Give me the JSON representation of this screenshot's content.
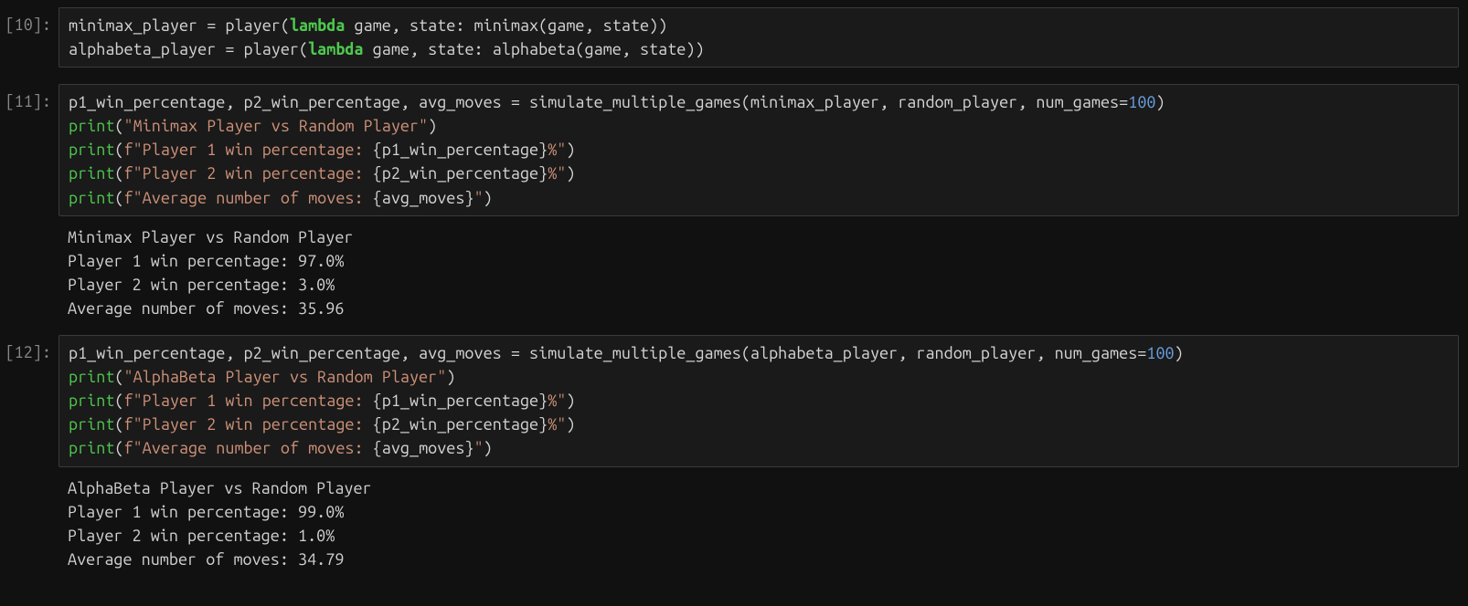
{
  "cells": [
    {
      "prompt": "[10]:",
      "code": [
        [
          {
            "t": "minimax_player ",
            "c": "tk-default"
          },
          {
            "t": "=",
            "c": "tk-op"
          },
          {
            "t": " player(",
            "c": "tk-default"
          },
          {
            "t": "lambda",
            "c": "tk-keyword"
          },
          {
            "t": " game, state: minimax(game, state))",
            "c": "tk-default"
          }
        ],
        [
          {
            "t": "alphabeta_player ",
            "c": "tk-default"
          },
          {
            "t": "=",
            "c": "tk-op"
          },
          {
            "t": " player(",
            "c": "tk-default"
          },
          {
            "t": "lambda",
            "c": "tk-keyword"
          },
          {
            "t": " game, state: alphabeta(game, state))",
            "c": "tk-default"
          }
        ]
      ],
      "output": []
    },
    {
      "prompt": "[11]:",
      "code": [
        [
          {
            "t": "p1_win_percentage, p2_win_percentage, avg_moves ",
            "c": "tk-default"
          },
          {
            "t": "=",
            "c": "tk-op"
          },
          {
            "t": " simulate_multiple_games(minimax_player, random_player, num_games",
            "c": "tk-default"
          },
          {
            "t": "=",
            "c": "tk-op"
          },
          {
            "t": "100",
            "c": "tk-number"
          },
          {
            "t": ")",
            "c": "tk-default"
          }
        ],
        [
          {
            "t": "print",
            "c": "tk-func"
          },
          {
            "t": "(",
            "c": "tk-default"
          },
          {
            "t": "\"Minimax Player vs Random Player\"",
            "c": "tk-string"
          },
          {
            "t": ")",
            "c": "tk-default"
          }
        ],
        [
          {
            "t": "print",
            "c": "tk-func"
          },
          {
            "t": "(",
            "c": "tk-default"
          },
          {
            "t": "f\"Player 1 win percentage: ",
            "c": "tk-fstring"
          },
          {
            "t": "{p1_win_percentage}",
            "c": "tk-interp"
          },
          {
            "t": "%\"",
            "c": "tk-fstring"
          },
          {
            "t": ")",
            "c": "tk-default"
          }
        ],
        [
          {
            "t": "print",
            "c": "tk-func"
          },
          {
            "t": "(",
            "c": "tk-default"
          },
          {
            "t": "f\"Player 2 win percentage: ",
            "c": "tk-fstring"
          },
          {
            "t": "{p2_win_percentage}",
            "c": "tk-interp"
          },
          {
            "t": "%\"",
            "c": "tk-fstring"
          },
          {
            "t": ")",
            "c": "tk-default"
          }
        ],
        [
          {
            "t": "print",
            "c": "tk-func"
          },
          {
            "t": "(",
            "c": "tk-default"
          },
          {
            "t": "f\"Average number of moves: ",
            "c": "tk-fstring"
          },
          {
            "t": "{avg_moves}",
            "c": "tk-interp"
          },
          {
            "t": "\"",
            "c": "tk-fstring"
          },
          {
            "t": ")",
            "c": "tk-default"
          }
        ]
      ],
      "output": [
        "Minimax Player vs Random Player",
        "Player 1 win percentage: 97.0%",
        "Player 2 win percentage: 3.0%",
        "Average number of moves: 35.96"
      ]
    },
    {
      "prompt": "[12]:",
      "code": [
        [
          {
            "t": "p1_win_percentage, p2_win_percentage, avg_moves ",
            "c": "tk-default"
          },
          {
            "t": "=",
            "c": "tk-op"
          },
          {
            "t": " simulate_multiple_games(alphabeta_player, random_player, num_games",
            "c": "tk-default"
          },
          {
            "t": "=",
            "c": "tk-op"
          },
          {
            "t": "100",
            "c": "tk-number"
          },
          {
            "t": ")",
            "c": "tk-default"
          }
        ],
        [
          {
            "t": "print",
            "c": "tk-func"
          },
          {
            "t": "(",
            "c": "tk-default"
          },
          {
            "t": "\"AlphaBeta Player vs Random Player\"",
            "c": "tk-string"
          },
          {
            "t": ")",
            "c": "tk-default"
          }
        ],
        [
          {
            "t": "print",
            "c": "tk-func"
          },
          {
            "t": "(",
            "c": "tk-default"
          },
          {
            "t": "f\"Player 1 win percentage: ",
            "c": "tk-fstring"
          },
          {
            "t": "{p1_win_percentage}",
            "c": "tk-interp"
          },
          {
            "t": "%\"",
            "c": "tk-fstring"
          },
          {
            "t": ")",
            "c": "tk-default"
          }
        ],
        [
          {
            "t": "print",
            "c": "tk-func"
          },
          {
            "t": "(",
            "c": "tk-default"
          },
          {
            "t": "f\"Player 2 win percentage: ",
            "c": "tk-fstring"
          },
          {
            "t": "{p2_win_percentage}",
            "c": "tk-interp"
          },
          {
            "t": "%\"",
            "c": "tk-fstring"
          },
          {
            "t": ")",
            "c": "tk-default"
          }
        ],
        [
          {
            "t": "print",
            "c": "tk-func"
          },
          {
            "t": "(",
            "c": "tk-default"
          },
          {
            "t": "f\"Average number of moves: ",
            "c": "tk-fstring"
          },
          {
            "t": "{avg_moves}",
            "c": "tk-interp"
          },
          {
            "t": "\"",
            "c": "tk-fstring"
          },
          {
            "t": ")",
            "c": "tk-default"
          }
        ]
      ],
      "output": [
        "AlphaBeta Player vs Random Player",
        "Player 1 win percentage: 99.0%",
        "Player 2 win percentage: 1.0%",
        "Average number of moves: 34.79"
      ]
    }
  ]
}
